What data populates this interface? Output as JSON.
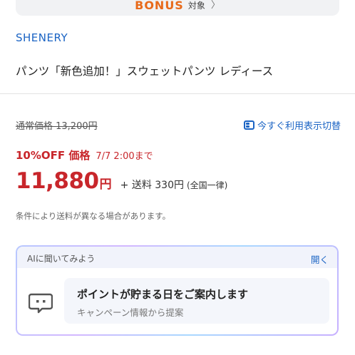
{
  "bonus": {
    "word": "BONUS",
    "suffix": "対象",
    "chevron": "〉"
  },
  "product": {
    "brand": "SHENERY",
    "title": "パンツ「新色追加！」スウェットパンツ レディース"
  },
  "pricing": {
    "regular": "通常価格 13,200円",
    "display_toggle": "今すぐ利用表示切替",
    "discount_label": "10%OFF 価格",
    "discount_until": "7/7 2:00まで",
    "price": "11,880",
    "price_unit": "円",
    "shipping": "+ 送料 330円",
    "shipping_note": "(全国一律)",
    "condition_note": "条件により送料が異なる場合があります。"
  },
  "ai": {
    "prompt": "AIに聞いてみよう",
    "open_label": "開く",
    "suggestion_title": "ポイントが貯まる日をご案内します",
    "suggestion_sub": "キャンペーン情報から提案"
  },
  "colors": {
    "accent_blue": "#1b64c4",
    "price_red": "#c8262b",
    "bonus_orange": "#e86a1a"
  },
  "icons": [
    "chevron-right-icon",
    "display-toggle-icon",
    "ai-chat-icon"
  ]
}
